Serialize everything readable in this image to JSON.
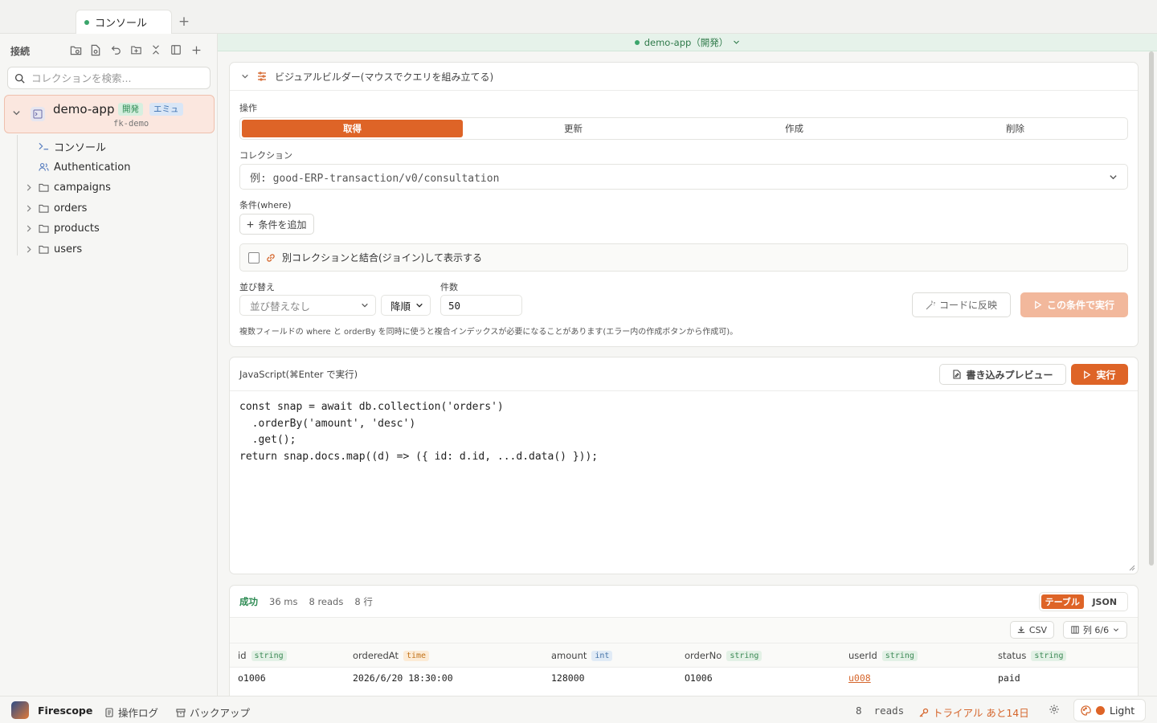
{
  "tabs": [
    {
      "label": "コンソール",
      "active": true
    }
  ],
  "sidebar": {
    "header": "接続",
    "search_placeholder": "コレクションを検索...",
    "connection": {
      "name": "demo-app",
      "badge_dev": "開発",
      "badge_emu": "エミュ",
      "project": "fk-demo"
    },
    "items": [
      {
        "label": "コンソール",
        "icon": "terminal-icon",
        "expandable": false
      },
      {
        "label": "Authentication",
        "icon": "users-icon",
        "expandable": false
      },
      {
        "label": "campaigns",
        "icon": "folder-icon",
        "expandable": true
      },
      {
        "label": "orders",
        "icon": "folder-icon",
        "expandable": true
      },
      {
        "label": "products",
        "icon": "folder-icon",
        "expandable": true
      },
      {
        "label": "users",
        "icon": "folder-icon",
        "expandable": true
      }
    ]
  },
  "connection_bar": "demo-app（開発）",
  "builder": {
    "title": "ビジュアルビルダー(マウスでクエリを組み立てる)",
    "operation_label": "操作",
    "operations": [
      {
        "label": "取得",
        "active": true
      },
      {
        "label": "更新",
        "active": false
      },
      {
        "label": "作成",
        "active": false
      },
      {
        "label": "削除",
        "active": false
      }
    ],
    "collection_label": "コレクション",
    "collection_placeholder": "例: good-ERP-transaction/v0/consultation",
    "where_label": "条件(where)",
    "add_condition": "条件を追加",
    "join_label": "別コレクションと結合(ジョイン)して表示する",
    "sort_label": "並び替え",
    "sort_value": "並び替えなし",
    "order_value": "降順",
    "limit_label": "件数",
    "limit_value": "50",
    "reflect_button": "コードに反映",
    "run_button": "この条件で実行",
    "hint": "複数フィールドの where と orderBy を同時に使うと複合インデックスが必要になることがあります(エラー内の作成ボタンから作成可)。"
  },
  "editor": {
    "title": "JavaScript(⌘Enter で実行)",
    "preview_button": "書き込みプレビュー",
    "run_button": "実行",
    "code": "const snap = await db.collection('orders')\n  .orderBy('amount', 'desc')\n  .get();\nreturn snap.docs.map((d) => ({ id: d.id, ...d.data() }));"
  },
  "results": {
    "status": "成功",
    "time": "36 ms",
    "reads": "8 reads",
    "rows": "8 行",
    "view_table": "テーブル",
    "view_json": "JSON",
    "csv_button": "CSV",
    "columns_button": "列 6/6",
    "columns": [
      {
        "name": "id",
        "type": "string"
      },
      {
        "name": "orderedAt",
        "type": "time"
      },
      {
        "name": "amount",
        "type": "int"
      },
      {
        "name": "orderNo",
        "type": "string"
      },
      {
        "name": "userId",
        "type": "string"
      },
      {
        "name": "status",
        "type": "string"
      }
    ],
    "row": [
      "o1006",
      "2026/6/20 18:30:00",
      "128000",
      "O1006",
      "u008",
      "paid"
    ]
  },
  "statusbar": {
    "app_name": "Firescope",
    "log": "操作ログ",
    "backup": "バックアップ",
    "reads": "8  reads",
    "trial": "トライアル あと14日",
    "theme": "Light"
  },
  "colors": {
    "accent": "#de6427",
    "success": "#2c8a52"
  }
}
